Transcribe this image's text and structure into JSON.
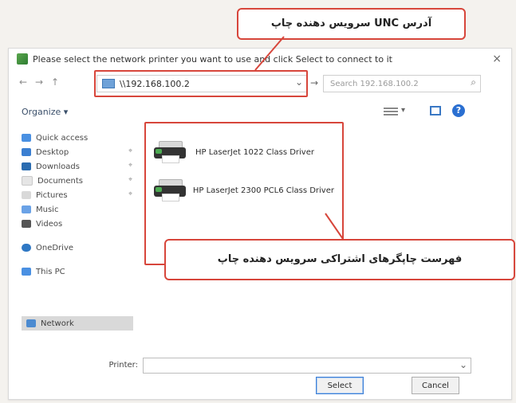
{
  "window": {
    "title": "Please select the network printer you want to use and click Select to connect to it",
    "close_label": "×"
  },
  "address": {
    "value": "\\\\192.168.100.2",
    "search_placeholder": "Search 192.168.100.2"
  },
  "command_bar": {
    "organize_label": "Organize ▾",
    "help_label": "?"
  },
  "sidebar": {
    "items": [
      {
        "label": "Quick access",
        "icon": "star-icon",
        "pinned": false
      },
      {
        "label": "Desktop",
        "icon": "desktop-icon",
        "pinned": true
      },
      {
        "label": "Downloads",
        "icon": "download-icon",
        "pinned": true
      },
      {
        "label": "Documents",
        "icon": "documents-icon",
        "pinned": true
      },
      {
        "label": "Pictures",
        "icon": "pictures-icon",
        "pinned": true
      },
      {
        "label": "Music",
        "icon": "music-icon",
        "pinned": false
      },
      {
        "label": "Videos",
        "icon": "videos-icon",
        "pinned": false
      },
      {
        "label": "OneDrive",
        "icon": "onedrive-icon",
        "pinned": false
      },
      {
        "label": "This PC",
        "icon": "pc-icon",
        "pinned": false
      }
    ],
    "network_label": "Network"
  },
  "files": {
    "items": [
      {
        "name": "HP LaserJet 1022 Class Driver",
        "icon": "printer-icon"
      },
      {
        "name": "HP LaserJet 2300 PCL6 Class Driver",
        "icon": "printer-icon"
      }
    ]
  },
  "printer_field": {
    "label": "Printer:",
    "value": ""
  },
  "buttons": {
    "select_label": "Select",
    "cancel_label": "Cancel"
  },
  "callouts": {
    "top": "آدرس UNC سرویس دهنده چاپ",
    "bottom": "فهرست چاپگرهای اشتراکی سرویس دهنده چاپ"
  },
  "colors": {
    "callout_border": "#d7463b",
    "accent_blue": "#2a6fd1"
  }
}
